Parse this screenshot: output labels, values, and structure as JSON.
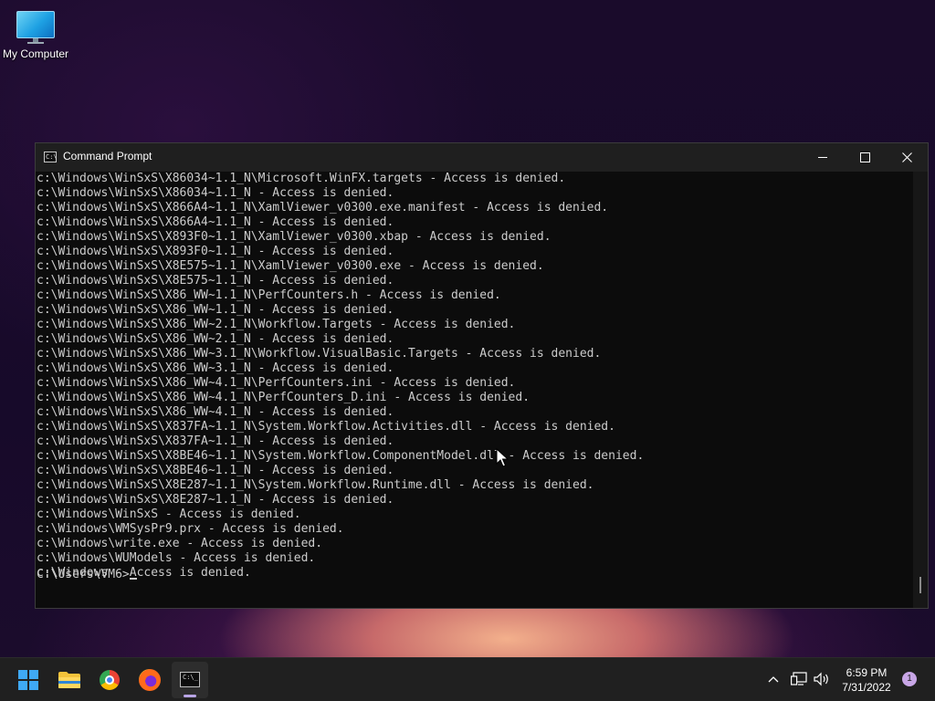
{
  "desktop": {
    "icons": [
      {
        "label": "My Computer",
        "icon": "monitor-icon"
      }
    ]
  },
  "window": {
    "title": "Command Prompt",
    "controls": {
      "minimize": "minimize-icon",
      "maximize": "maximize-icon",
      "close": "close-icon"
    },
    "console_lines": [
      "c:\\Windows\\WinSxS\\X86034~1.1_N\\Microsoft.WinFX.targets - Access is denied.",
      "c:\\Windows\\WinSxS\\X86034~1.1_N - Access is denied.",
      "c:\\Windows\\WinSxS\\X866A4~1.1_N\\XamlViewer_v0300.exe.manifest - Access is denied.",
      "c:\\Windows\\WinSxS\\X866A4~1.1_N - Access is denied.",
      "c:\\Windows\\WinSxS\\X893F0~1.1_N\\XamlViewer_v0300.xbap - Access is denied.",
      "c:\\Windows\\WinSxS\\X893F0~1.1_N - Access is denied.",
      "c:\\Windows\\WinSxS\\X8E575~1.1_N\\XamlViewer_v0300.exe - Access is denied.",
      "c:\\Windows\\WinSxS\\X8E575~1.1_N - Access is denied.",
      "c:\\Windows\\WinSxS\\X86_WW~1.1_N\\PerfCounters.h - Access is denied.",
      "c:\\Windows\\WinSxS\\X86_WW~1.1_N - Access is denied.",
      "c:\\Windows\\WinSxS\\X86_WW~2.1_N\\Workflow.Targets - Access is denied.",
      "c:\\Windows\\WinSxS\\X86_WW~2.1_N - Access is denied.",
      "c:\\Windows\\WinSxS\\X86_WW~3.1_N\\Workflow.VisualBasic.Targets - Access is denied.",
      "c:\\Windows\\WinSxS\\X86_WW~3.1_N - Access is denied.",
      "c:\\Windows\\WinSxS\\X86_WW~4.1_N\\PerfCounters.ini - Access is denied.",
      "c:\\Windows\\WinSxS\\X86_WW~4.1_N\\PerfCounters_D.ini - Access is denied.",
      "c:\\Windows\\WinSxS\\X86_WW~4.1_N - Access is denied.",
      "c:\\Windows\\WinSxS\\X837FA~1.1_N\\System.Workflow.Activities.dll - Access is denied.",
      "c:\\Windows\\WinSxS\\X837FA~1.1_N - Access is denied.",
      "c:\\Windows\\WinSxS\\X8BE46~1.1_N\\System.Workflow.ComponentModel.dll - Access is denied.",
      "c:\\Windows\\WinSxS\\X8BE46~1.1_N - Access is denied.",
      "c:\\Windows\\WinSxS\\X8E287~1.1_N\\System.Workflow.Runtime.dll - Access is denied.",
      "c:\\Windows\\WinSxS\\X8E287~1.1_N - Access is denied.",
      "c:\\Windows\\WinSxS - Access is denied.",
      "c:\\Windows\\WMSysPr9.prx - Access is denied.",
      "c:\\Windows\\write.exe - Access is denied.",
      "c:\\Windows\\WUModels - Access is denied.",
      "c:\\Windows - Access is denied.",
      ""
    ],
    "prompt": "C:\\Users\\VM6>"
  },
  "taskbar": {
    "apps": [
      {
        "name": "start",
        "icon": "windows-start-icon",
        "active": false
      },
      {
        "name": "file-explorer",
        "icon": "folder-icon",
        "active": false
      },
      {
        "name": "chrome",
        "icon": "chrome-icon",
        "active": false
      },
      {
        "name": "firefox",
        "icon": "firefox-icon",
        "active": false
      },
      {
        "name": "command-prompt",
        "icon": "cmd-icon",
        "active": true
      }
    ],
    "tray": {
      "icons": [
        "chevron-up-icon",
        "network-icon",
        "volume-icon"
      ],
      "time": "6:59 PM",
      "date": "7/31/2022",
      "notification_count": "1"
    }
  },
  "colors": {
    "console_bg": "#0c0c0c",
    "console_text": "#cccccc",
    "titlebar": "#1f1f1f",
    "taskbar": "#202020",
    "accent": "#3fa9f5"
  }
}
